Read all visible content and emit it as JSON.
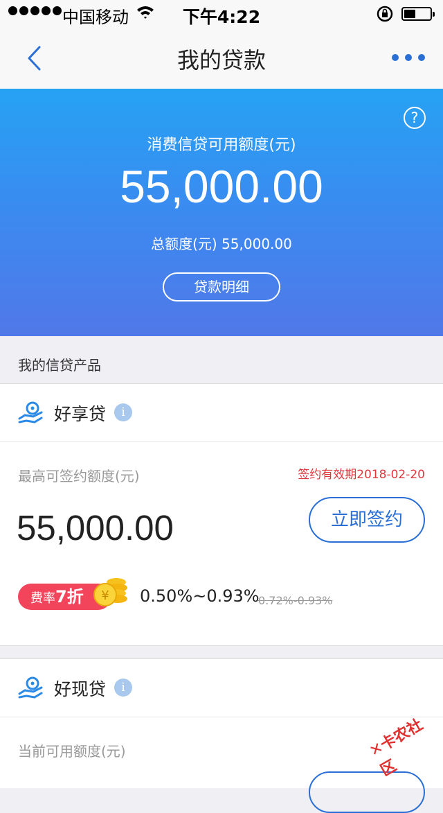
{
  "status_bar": {
    "carrier": "中国移动",
    "time": "下午4:22",
    "battery_level": 0.4
  },
  "nav": {
    "title": "我的贷款"
  },
  "hero": {
    "label": "消费信贷可用额度(元)",
    "amount": "55,000.00",
    "total_label": "总额度(元)",
    "total_amount": "55,000.00",
    "details_button": "贷款明细",
    "help_icon_text": "?"
  },
  "section_title": "我的信贷产品",
  "products": [
    {
      "name": "好享贷",
      "limit_label": "最高可签约额度(元)",
      "expiry": "签约有效期2018-02-20",
      "limit_amount": "55,000.00",
      "sign_button": "立即签约",
      "badge_prefix": "费率",
      "badge_discount": "7折",
      "rate_current": "0.50%~0.93%",
      "rate_original": "0.72%-0.93%"
    },
    {
      "name": "好现贷",
      "limit_label": "当前可用额度(元)"
    }
  ],
  "watermark": "卡农社区",
  "colors": {
    "accent": "#2a6fd6",
    "hero_top": "#26a2f3",
    "hero_bottom": "#5178e8",
    "alert": "#e0373d",
    "badge": "#f2445a"
  }
}
